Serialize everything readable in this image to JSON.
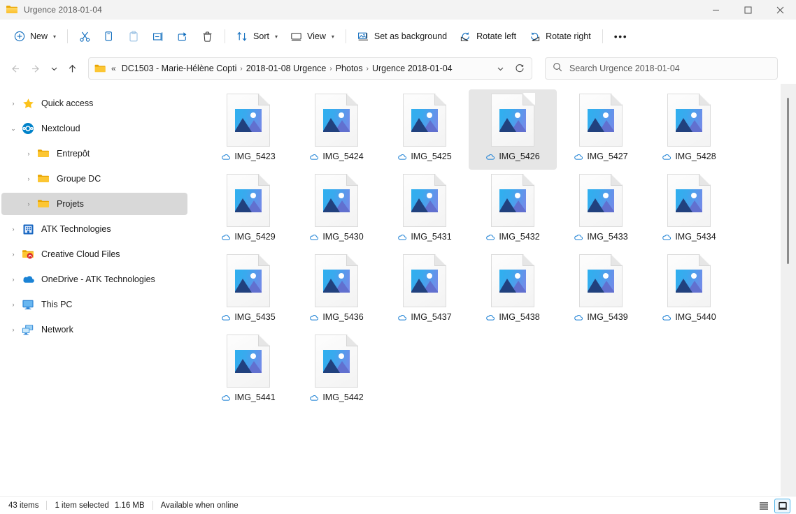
{
  "window": {
    "title": "Urgence 2018-01-04",
    "folder_icon": "folder-icon",
    "minimize_label": "—",
    "maximize_label": "□",
    "close_label": "✕"
  },
  "toolbar": {
    "new_label": "New",
    "cut_label": "Cut",
    "copy_label": "Copy",
    "paste_label": "Paste",
    "rename_label": "Rename",
    "share_label": "Share",
    "delete_label": "Delete",
    "sort_label": "Sort",
    "view_label": "View",
    "set_as_background_label": "Set as background",
    "rotate_left_label": "Rotate left",
    "rotate_right_label": "Rotate right",
    "more_label": "•••"
  },
  "address": {
    "back_label": "←",
    "forward_label": "→",
    "recent_label": "⌄",
    "up_label": "↑",
    "overflow_label": "«",
    "crumbs": [
      "DC1503 - Marie-Hélène Copti",
      "2018-01-08 Urgence",
      "Photos",
      "Urgence 2018-01-04"
    ],
    "separator": "›",
    "dropdown_label": "⌄",
    "refresh_label": "↻"
  },
  "search": {
    "placeholder": "Search Urgence 2018-01-04",
    "icon": "search-icon"
  },
  "sidebar": {
    "items": [
      {
        "label": "Quick access",
        "icon": "star-icon",
        "indent": false,
        "expanded": false,
        "selected": false
      },
      {
        "label": "Nextcloud",
        "icon": "nextcloud-icon",
        "indent": false,
        "expanded": true,
        "selected": false
      },
      {
        "label": "Entrepôt",
        "icon": "folder-icon",
        "indent": true,
        "expanded": false,
        "selected": false
      },
      {
        "label": "Groupe DC",
        "icon": "folder-icon",
        "indent": true,
        "expanded": false,
        "selected": false
      },
      {
        "label": "Projets",
        "icon": "folder-icon",
        "indent": true,
        "expanded": false,
        "selected": true
      },
      {
        "label": "ATK Technologies",
        "icon": "building-icon",
        "indent": false,
        "expanded": false,
        "selected": false
      },
      {
        "label": "Creative Cloud Files",
        "icon": "creative-cloud-icon",
        "indent": false,
        "expanded": false,
        "selected": false
      },
      {
        "label": "OneDrive - ATK Technologies",
        "icon": "onedrive-icon",
        "indent": false,
        "expanded": false,
        "selected": false
      },
      {
        "label": "This PC",
        "icon": "this-pc-icon",
        "indent": false,
        "expanded": false,
        "selected": false
      },
      {
        "label": "Network",
        "icon": "network-icon",
        "indent": false,
        "expanded": false,
        "selected": false
      }
    ],
    "expander_collapsed": "›",
    "expander_expanded": "⌄"
  },
  "files": [
    {
      "name": "IMG_5423",
      "selected": false
    },
    {
      "name": "IMG_5424",
      "selected": false
    },
    {
      "name": "IMG_5425",
      "selected": false
    },
    {
      "name": "IMG_5426",
      "selected": true
    },
    {
      "name": "IMG_5427",
      "selected": false
    },
    {
      "name": "IMG_5428",
      "selected": false
    },
    {
      "name": "IMG_5429",
      "selected": false
    },
    {
      "name": "IMG_5430",
      "selected": false
    },
    {
      "name": "IMG_5431",
      "selected": false
    },
    {
      "name": "IMG_5432",
      "selected": false
    },
    {
      "name": "IMG_5433",
      "selected": false
    },
    {
      "name": "IMG_5434",
      "selected": false
    },
    {
      "name": "IMG_5435",
      "selected": false
    },
    {
      "name": "IMG_5436",
      "selected": false
    },
    {
      "name": "IMG_5437",
      "selected": false
    },
    {
      "name": "IMG_5438",
      "selected": false
    },
    {
      "name": "IMG_5439",
      "selected": false
    },
    {
      "name": "IMG_5440",
      "selected": false
    },
    {
      "name": "IMG_5441",
      "selected": false
    },
    {
      "name": "IMG_5442",
      "selected": false
    }
  ],
  "status": {
    "item_count": "43 items",
    "selection": "1 item selected",
    "selection_size": "1.16 MB",
    "availability": "Available when online"
  },
  "view_toggles": {
    "details_label": "Details view",
    "icons_label": "Large icons view",
    "active": "icons"
  }
}
